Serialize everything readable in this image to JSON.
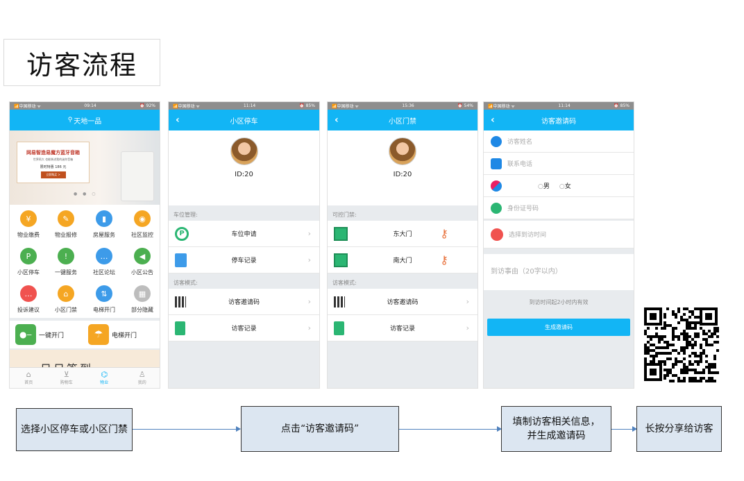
{
  "title": "访客流程",
  "phones": {
    "home": {
      "status_left": "📶中国移动 ᯤ",
      "status_time": "09:14",
      "status_right": "⏰ 92%",
      "header": "天地一品",
      "banner": {
        "title": "网易智造易魔方蓝牙音箱",
        "sub": "世界再大 也能装进我的迷你音箱",
        "price": "限时特惠 186 元",
        "btn": "立即购买 >"
      },
      "grid": [
        "物业缴费",
        "物业报修",
        "房屋服务",
        "社区监控",
        "小区停车",
        "一键服务",
        "社区论坛",
        "小区公告",
        "投诉建议",
        "小区门禁",
        "电梯开门",
        "部分隐藏"
      ],
      "quick": [
        "一键开门",
        "电梯开门"
      ],
      "promo": "日日签到",
      "tabs": [
        "首页",
        "购物车",
        "物业",
        "我的"
      ]
    },
    "parking": {
      "status_left": "📶中国移动 ᯤ",
      "status_time": "11:14",
      "status_right": "⏰ 85%",
      "header": "小区停车",
      "id": "ID:20",
      "section1": "车位管理:",
      "items1": [
        "车位申请",
        "停车记录"
      ],
      "section2": "访客模式:",
      "items2": [
        "访客邀请码",
        "访客记录"
      ]
    },
    "gate": {
      "status_left": "📶中国移动 ᯤ",
      "status_time": "15:36",
      "status_right": "⏰ 54%",
      "header": "小区门禁",
      "id": "ID:20",
      "section1": "可控门禁:",
      "items1": [
        "东大门",
        "南大门"
      ],
      "section2": "访客模式:",
      "items2": [
        "访客邀请码",
        "访客记录"
      ]
    },
    "invite": {
      "status_left": "📶中国移动 ᯤ",
      "status_time": "11:14",
      "status_right": "⏰ 85%",
      "header": "访客邀请码",
      "name_ph": "访客姓名",
      "phone_ph": "联系电话",
      "male": "男",
      "female": "女",
      "idcard_ph": "身份证号码",
      "time_ph": "选择到访时间",
      "reason_ph": "到访事由（20字以内）",
      "note": "到访时间起2小时内有效",
      "submit": "生成邀请码"
    }
  },
  "flow": {
    "step1": "选择小区停车或小区门禁",
    "step2": "点击“访客邀请码”",
    "step3a": "填制访客相关信息，",
    "step3b": "并生成邀请码",
    "step4": "长按分享给访客"
  },
  "colors": {
    "accent": "#12b5f5",
    "flow_fill": "#dce6f1",
    "arrow": "#4f81bd"
  }
}
